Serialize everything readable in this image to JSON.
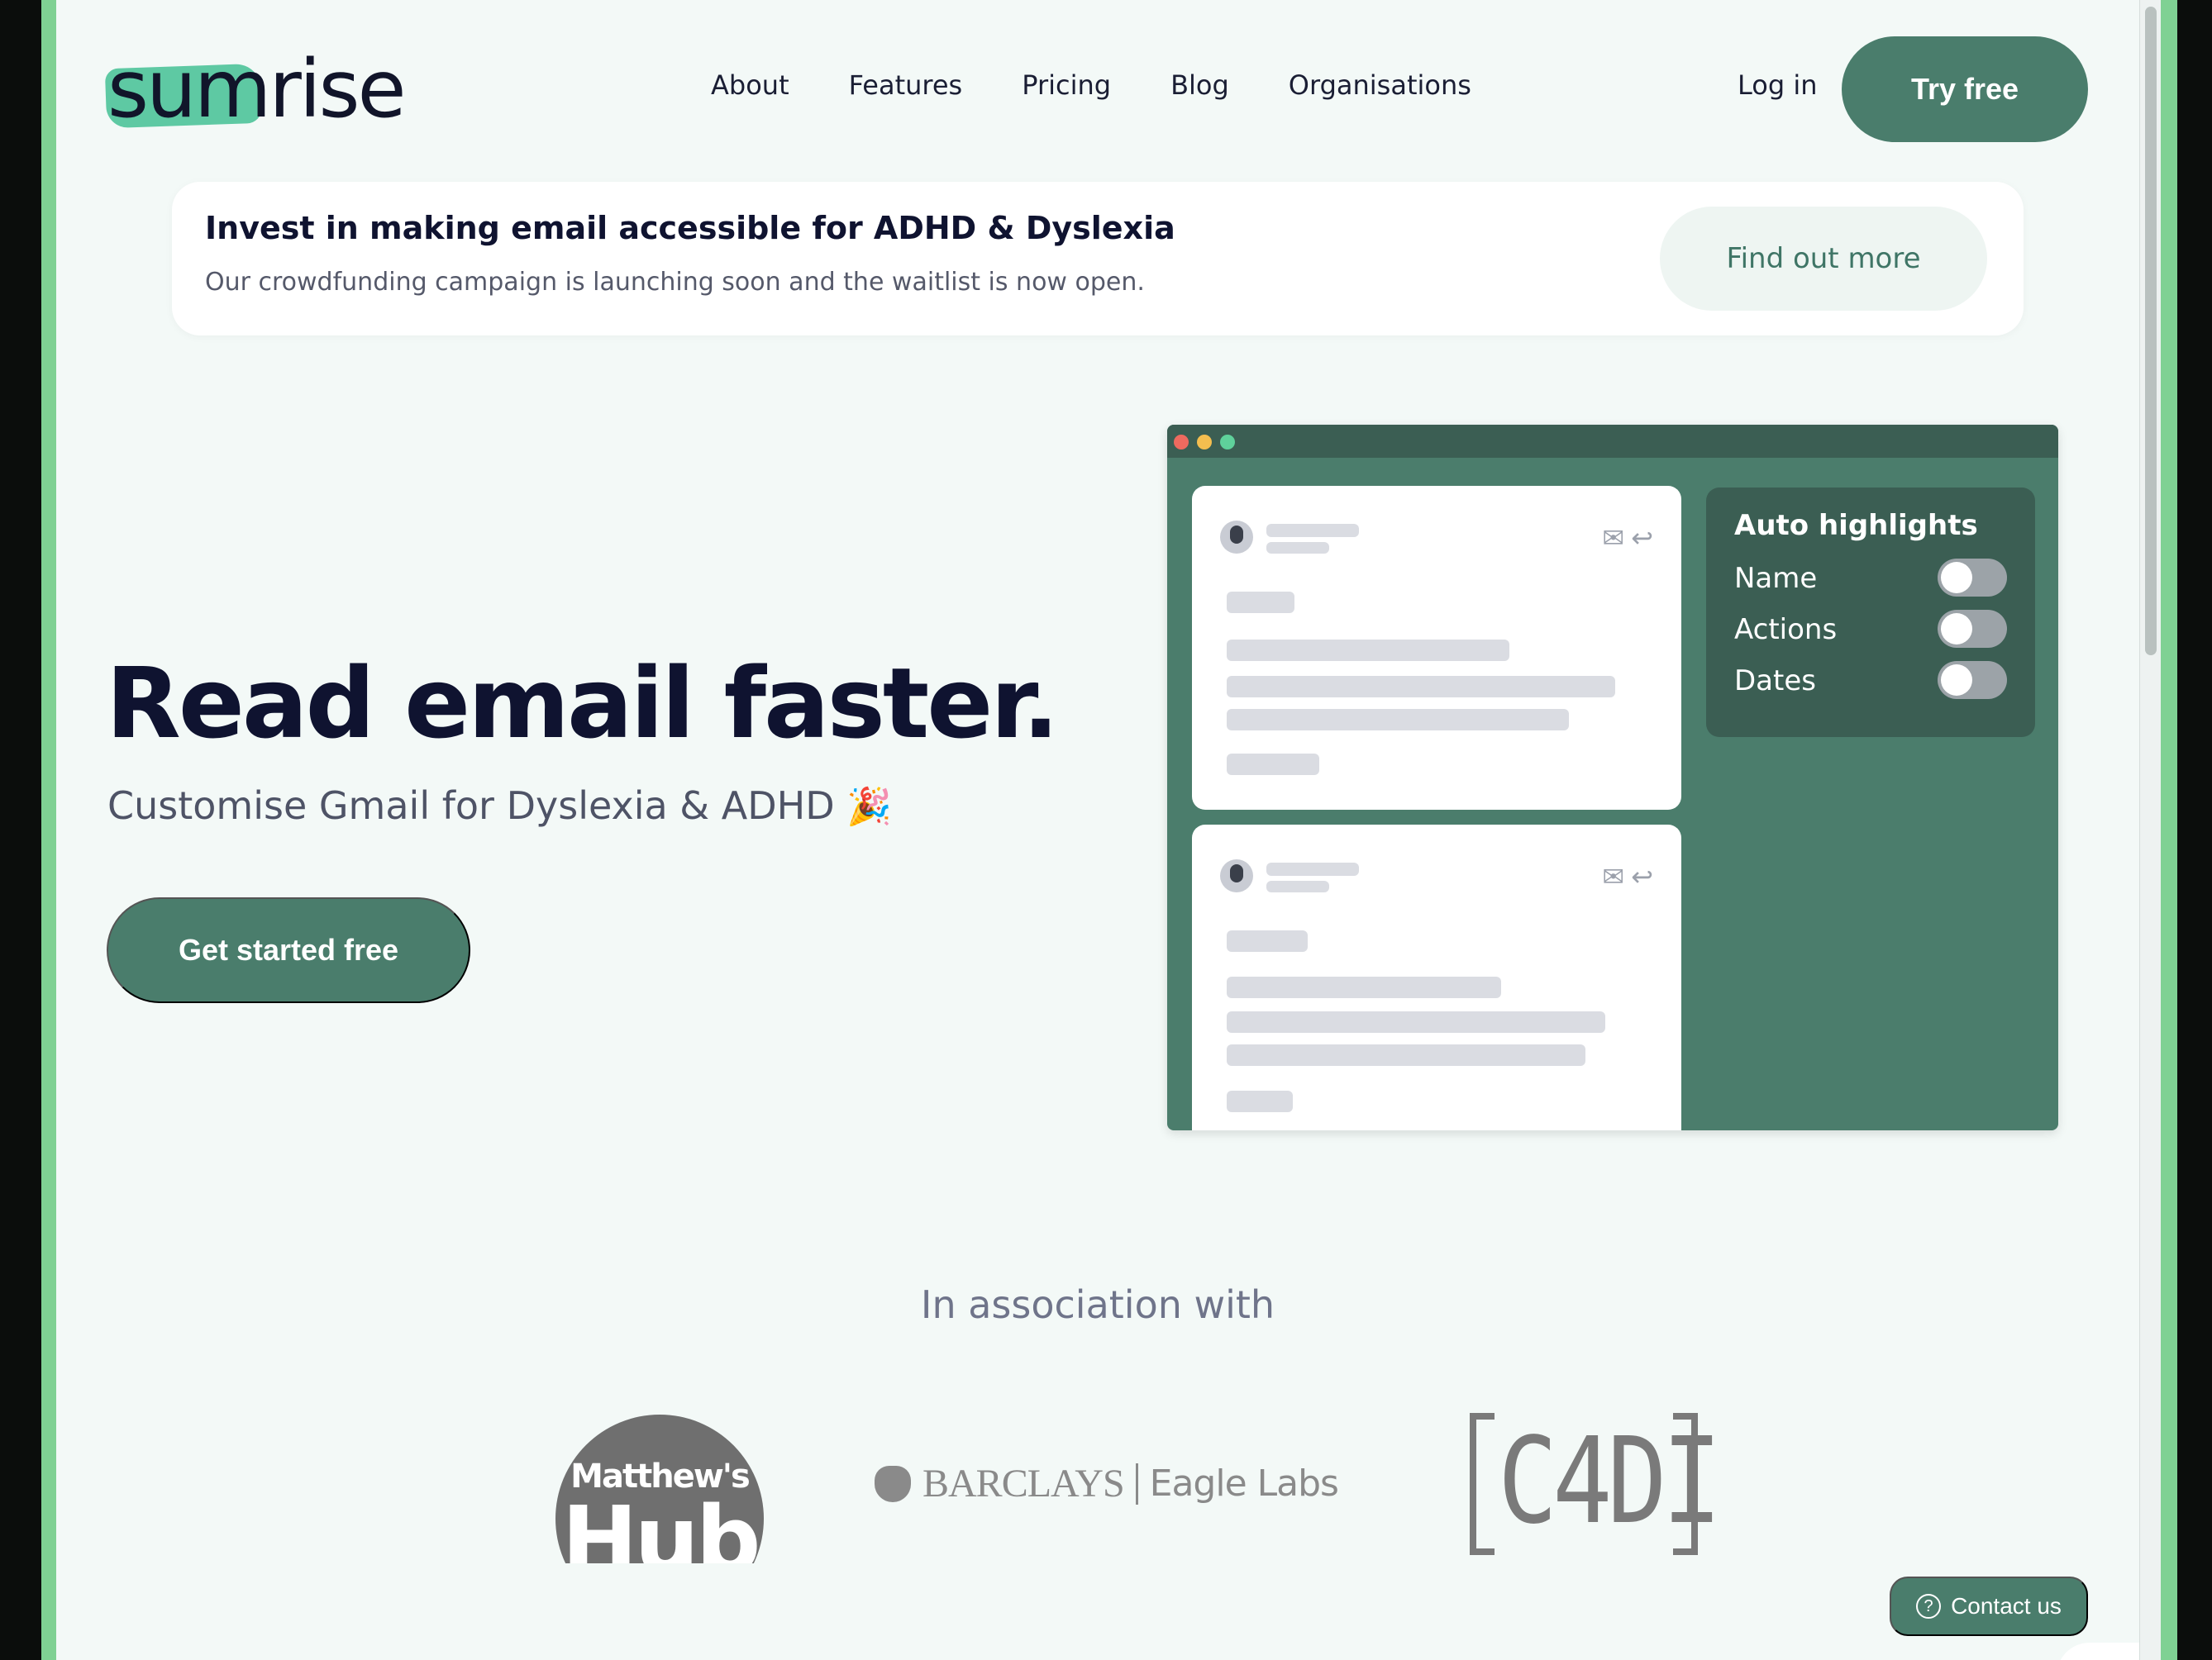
{
  "header": {
    "logo_text": "sumrise",
    "nav": [
      "About",
      "Features",
      "Pricing",
      "Blog",
      "Organisations"
    ],
    "login": "Log in",
    "try_free": "Try free"
  },
  "banner": {
    "title": "Invest in making email accessible for ADHD & Dyslexia",
    "subtitle": "Our crowdfunding campaign is launching soon and the waitlist is now open.",
    "button": "Find out more"
  },
  "hero": {
    "title": "Read email faster.",
    "subtitle": "Customise Gmail for Dyslexia & ADHD",
    "emoji": "🎉",
    "cta": "Get started free"
  },
  "mock": {
    "panel_title": "Auto highlights",
    "toggles": [
      {
        "label": "Name",
        "on": false
      },
      {
        "label": "Actions",
        "on": false
      },
      {
        "label": "Dates",
        "on": false
      }
    ],
    "window_dots": [
      "#ee6a5f",
      "#f4be4f",
      "#5fd19b"
    ]
  },
  "association": {
    "heading": "In association with",
    "partners": {
      "matthews_hub_top": "Matthew's",
      "matthews_hub_main": "Hub",
      "barclays_name": "BARCLAYS",
      "barclays_sub": "Eagle Labs",
      "c4di": "C4DI"
    }
  },
  "contact": {
    "label": "Contact us"
  },
  "colors": {
    "brand": "#4a7d6c",
    "brand_dark": "#3b5e53",
    "accent_logo": "#5ec9a3",
    "text_dark": "#0f1330",
    "background": "#f3f9f7"
  }
}
